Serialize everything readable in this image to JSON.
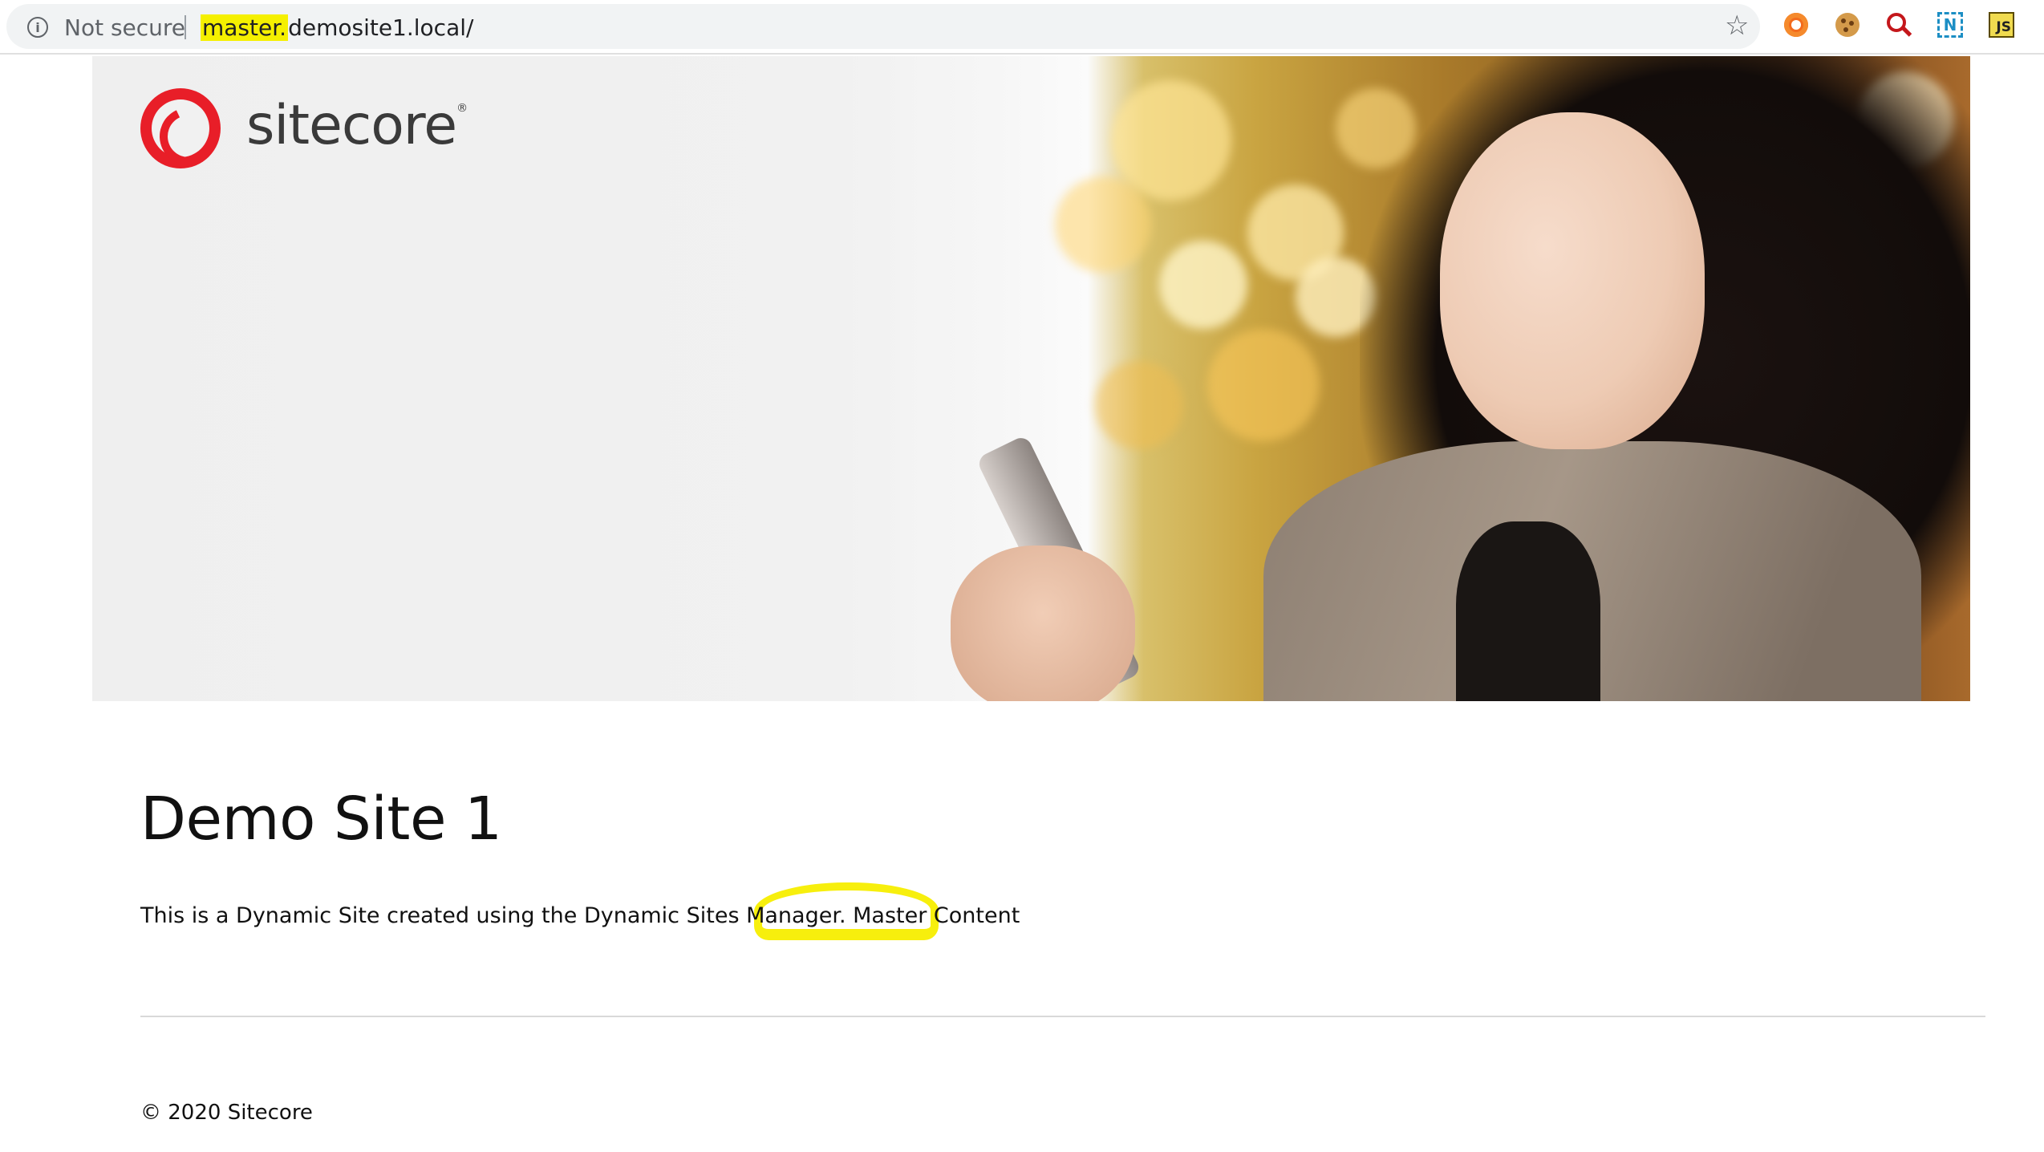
{
  "browser": {
    "security_label": "Not secure",
    "url_highlight": "master.",
    "url_rest": "demosite1.local/",
    "icons": {
      "info": "info-icon",
      "bookmark": "star-icon",
      "extensions": [
        "orange-extension-icon",
        "cookie-extension-icon",
        "red-search-extension-icon",
        "n-extension-icon",
        "js-extension-icon"
      ]
    },
    "ext_n_label": "N",
    "ext_js_label": "JS"
  },
  "hero": {
    "logo_text": "sitecore",
    "logo_mark": "®",
    "image": "woman-with-phone-photo"
  },
  "content": {
    "title": "Demo Site 1",
    "body": "This is a Dynamic Site created using the Dynamic Sites Manager. Master Content"
  },
  "footer": {
    "text": "© 2020 Sitecore"
  },
  "colors": {
    "highlight": "#f5f000",
    "logo_red": "#e81e28"
  }
}
